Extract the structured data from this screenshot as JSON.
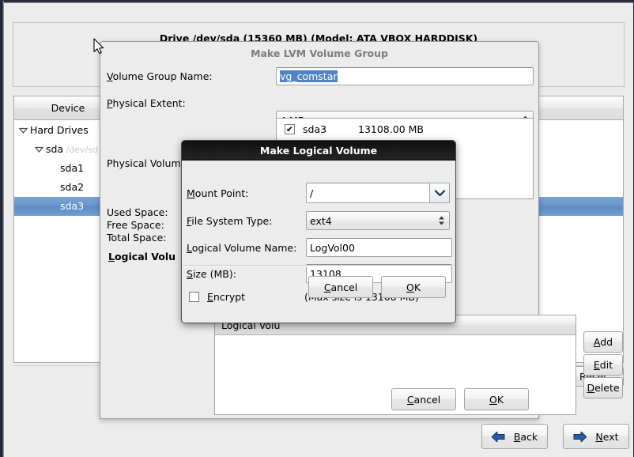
{
  "main_window": {
    "drive_title": "Drive /dev/sda (15360 MB) (Model: ATA VBOX HARDDISK)",
    "device_column_header": "Device",
    "tree": [
      {
        "label": "Hard Drives",
        "sub": "",
        "level": 1,
        "expander": "down",
        "selected": false
      },
      {
        "label": "sda",
        "sub": "/dev/sd",
        "level": 2,
        "expander": "down",
        "selected": false
      },
      {
        "label": "sda1",
        "sub": "",
        "level": 3,
        "expander": "none",
        "selected": false
      },
      {
        "label": "sda2",
        "sub": "",
        "level": 3,
        "expander": "none",
        "selected": false
      },
      {
        "label": "sda3",
        "sub": "",
        "level": 3,
        "expander": "none",
        "selected": true
      }
    ],
    "reset_label": "Reset",
    "reset_mnemonic": "s",
    "back_label": "Back",
    "back_mnemonic": "B",
    "next_label": "Next",
    "next_mnemonic": "N"
  },
  "lvm_dialog": {
    "title": "Make LVM Volume Group",
    "volume_group_name_label": "Volume Group Name:",
    "volume_group_name_mnemonic": "V",
    "volume_group_name_value": "vg_comstar",
    "physical_extent_label": "Physical Extent:",
    "physical_extent_mnemonic": "P",
    "physical_extent_value": "4 MB",
    "physical_volumes_label": "Physical Volum",
    "physical_volumes_items": [
      {
        "checked": true,
        "name": "sda3",
        "size": "13108.00 MB"
      }
    ],
    "used_space_label": "Used Space:",
    "free_space_label": "Free Space:",
    "total_space_label": "Total Space:",
    "logical_volumes_label": "Logical Volu",
    "logical_volumes_mnemonic": "L",
    "lv_column_header": "Logical Volu",
    "add_label": "Add",
    "add_mnemonic": "A",
    "edit_label": "Edit",
    "edit_mnemonic": "E",
    "delete_label": "Delete",
    "delete_mnemonic": "D",
    "cancel_label": "Cancel",
    "cancel_mnemonic": "C",
    "ok_label": "OK",
    "ok_mnemonic": "O"
  },
  "mlv_dialog": {
    "title": "Make Logical Volume",
    "mount_point_label": "Mount Point:",
    "mount_point_mnemonic": "M",
    "mount_point_value": "/",
    "file_system_type_label": "File System Type:",
    "file_system_type_mnemonic": "F",
    "file_system_type_value": "ext4",
    "logical_volume_name_label": "Logical Volume Name:",
    "logical_volume_name_mnemonic": "L",
    "logical_volume_name_value": "LogVol00",
    "size_label": "Size (MB):",
    "size_mnemonic": "S",
    "size_value": "13108",
    "encrypt_label": "Encrypt",
    "encrypt_mnemonic": "E",
    "encrypt_checked": false,
    "max_size_note": "(Max size is 13108 MB)",
    "cancel_label": "Cancel",
    "cancel_mnemonic": "C",
    "ok_label": "OK",
    "ok_mnemonic": "O"
  },
  "colors": {
    "selection_blue": "#5d8cc6",
    "window_bg": "#ececec",
    "dialog_title_gray": "#7d7d7d",
    "titlebar_black": "#141414",
    "arrow_blue": "#2b5ba8"
  }
}
